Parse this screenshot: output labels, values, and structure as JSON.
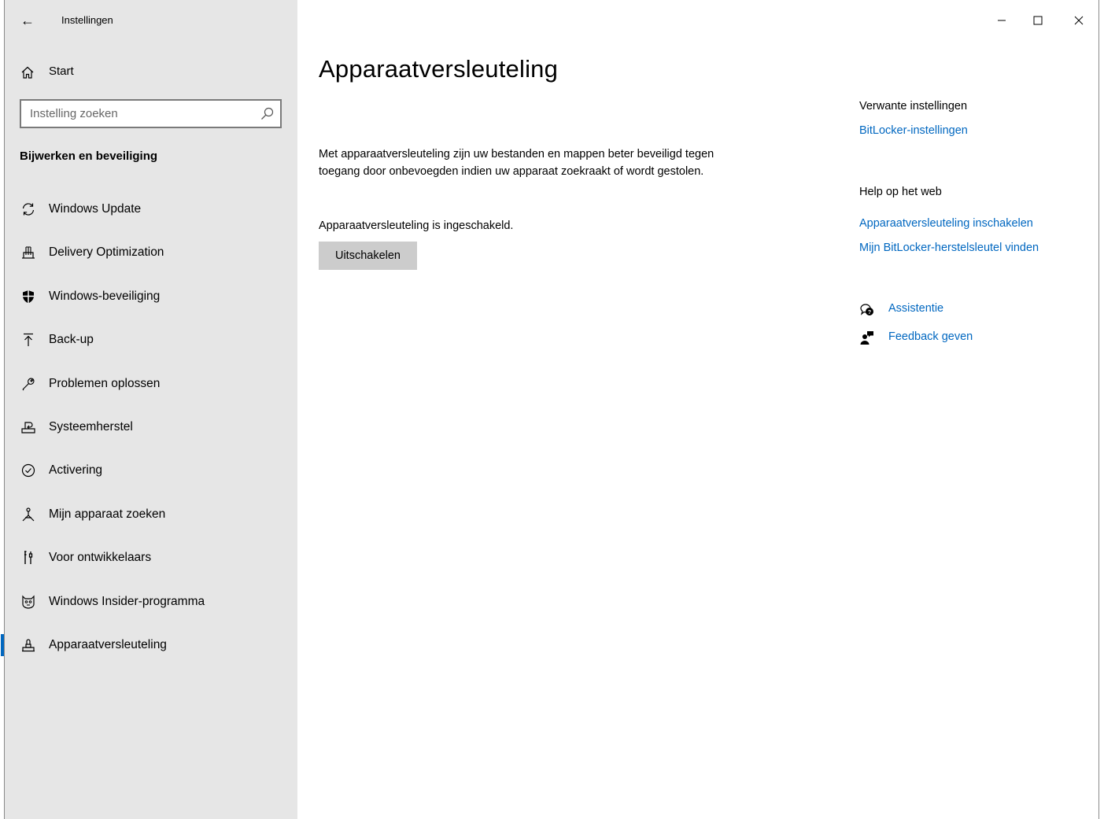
{
  "window": {
    "back_label": "←",
    "app_title": "Instellingen",
    "minimize_label": "–",
    "maximize_label": "□",
    "close_label": "✕"
  },
  "sidebar": {
    "home_label": "Start",
    "search_placeholder": "Instelling zoeken",
    "section_title": "Bijwerken en beveiliging",
    "items": [
      {
        "label": "Windows Update",
        "icon": "sync-icon"
      },
      {
        "label": "Delivery Optimization",
        "icon": "delivery-optimization-icon"
      },
      {
        "label": "Windows-beveiliging",
        "icon": "shield-icon"
      },
      {
        "label": "Back-up",
        "icon": "backup-arrow-icon"
      },
      {
        "label": "Problemen oplossen",
        "icon": "wrench-icon"
      },
      {
        "label": "Systeemherstel",
        "icon": "recovery-icon"
      },
      {
        "label": "Activering",
        "icon": "check-circle-icon"
      },
      {
        "label": "Mijn apparaat zoeken",
        "icon": "find-device-icon"
      },
      {
        "label": "Voor ontwikkelaars",
        "icon": "developer-tools-icon"
      },
      {
        "label": "Windows Insider-programma",
        "icon": "insider-cat-icon"
      },
      {
        "label": "Apparaatversleuteling",
        "icon": "device-encryption-icon",
        "active": true
      }
    ]
  },
  "main": {
    "title": "Apparaatversleuteling",
    "description": "Met apparaatversleuteling zijn uw bestanden en mappen beter beveiligd tegen toegang door onbevoegden indien uw apparaat zoekraakt of wordt gestolen.",
    "status": "Apparaatversleuteling is ingeschakeld.",
    "button_label": "Uitschakelen"
  },
  "right": {
    "related_heading": "Verwante instellingen",
    "related_link": "BitLocker-instellingen",
    "web_heading": "Help op het web",
    "web_links": [
      "Apparaatversleuteling inschakelen",
      "Mijn BitLocker-herstelsleutel vinden"
    ],
    "help_label": "Assistentie",
    "feedback_label": "Feedback geven"
  },
  "colors": {
    "accent": "#0067c0",
    "sidebar_bg": "#e6e6e6",
    "button_bg": "#cccccc"
  }
}
